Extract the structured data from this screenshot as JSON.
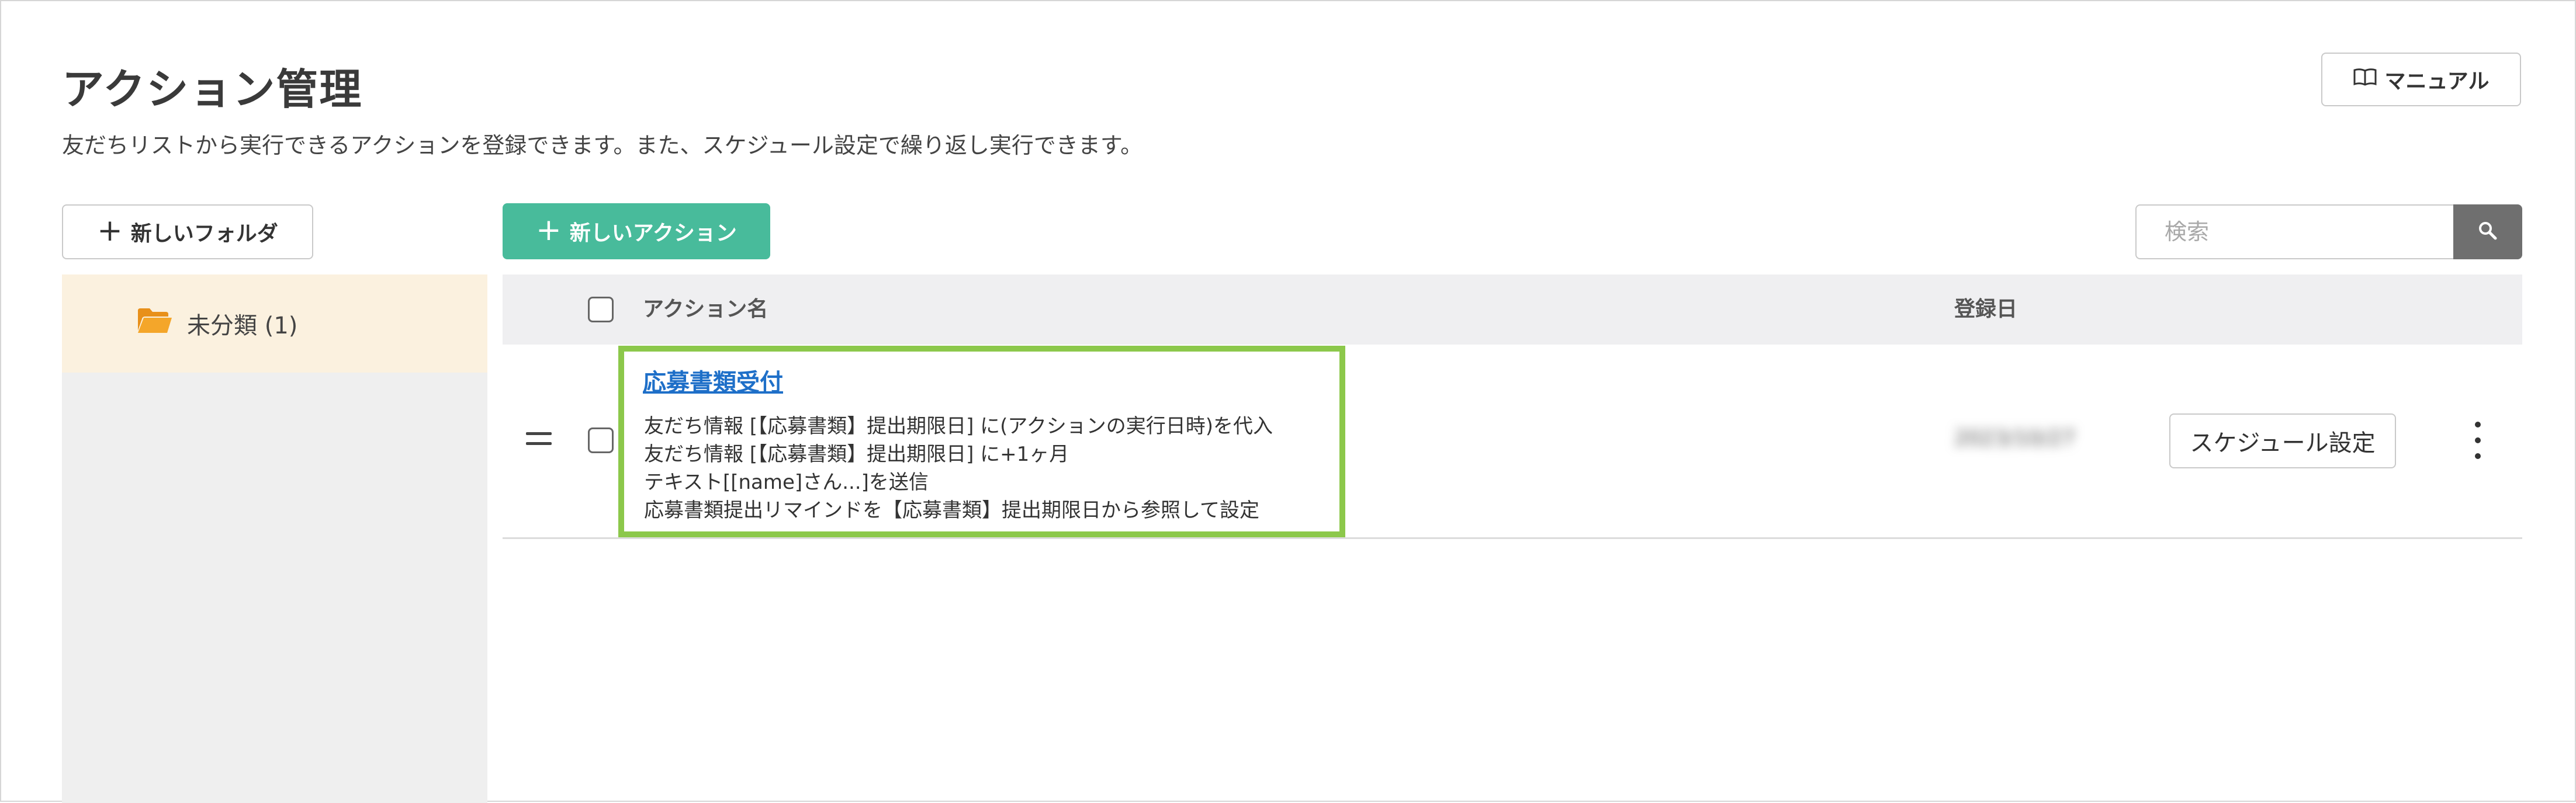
{
  "page": {
    "title": "アクション管理",
    "description": "友だちリストから実行できるアクションを登録できます。また、スケジュール設定で繰り返し実行できます。",
    "manual_label": "マニュアル"
  },
  "sidebar": {
    "new_folder_label": "新しいフォルダ",
    "folders": [
      {
        "label": "未分類 (1)",
        "icon": "folder-open-icon",
        "selected": true
      }
    ]
  },
  "toolbar": {
    "new_action_label": "新しいアクション",
    "search_placeholder": "検索"
  },
  "table": {
    "headers": {
      "name": "アクション名",
      "date": "登録日"
    },
    "rows": [
      {
        "name": "応募書類受付",
        "lines": [
          "友だち情報 [【応募書類】提出期限日] に(アクションの実行日時)を代入",
          "友だち情報 [【応募書類】提出期限日] に+1ヶ月",
          "テキスト[[name]さん...]を送信",
          "応募書類提出リマインドを【応募書類】提出期限日から参照して設定"
        ],
        "date": "2023/10/27",
        "schedule_label": "スケジュール設定"
      }
    ]
  },
  "colors": {
    "accent": "#48bb9b",
    "folder": "#f0a020",
    "highlight": "#8cc84b",
    "link": "#1e6fc8"
  }
}
